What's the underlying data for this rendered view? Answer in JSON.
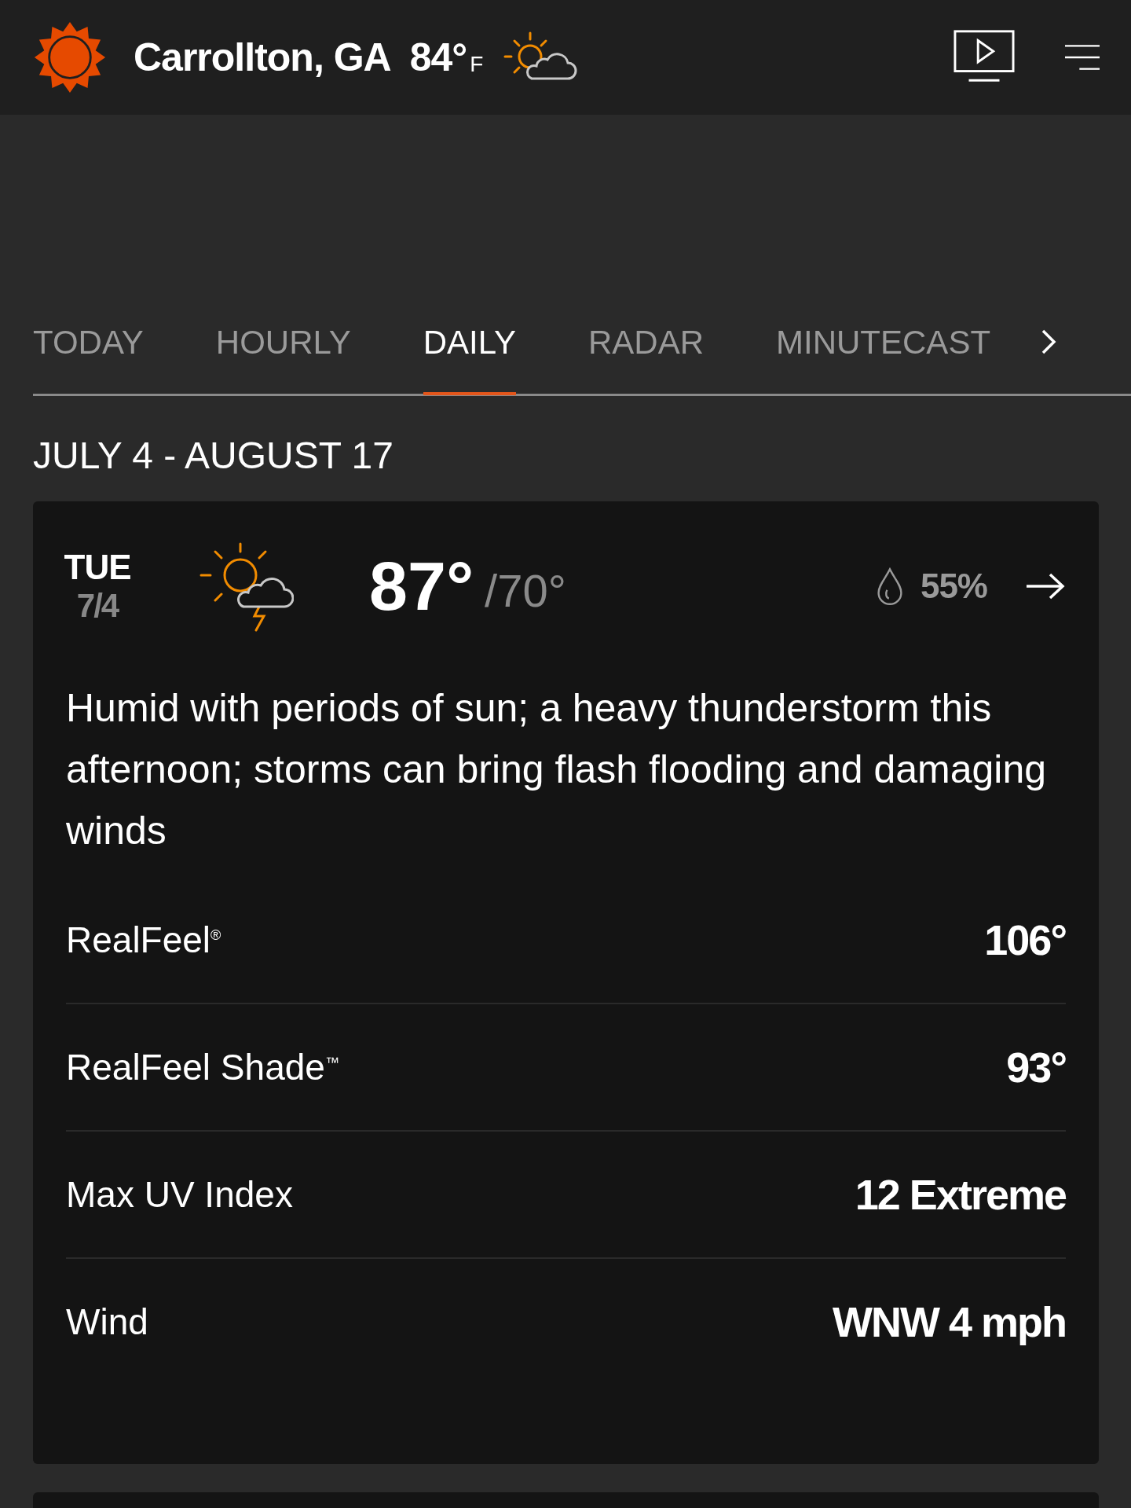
{
  "header": {
    "location": "Carrollton, GA",
    "temperature": "84°",
    "unit": "F"
  },
  "tabs": [
    {
      "label": "TODAY",
      "selected": false
    },
    {
      "label": "HOURLY",
      "selected": false
    },
    {
      "label": "DAILY",
      "selected": true
    },
    {
      "label": "RADAR",
      "selected": false
    },
    {
      "label": "MINUTECAST",
      "selected": false
    }
  ],
  "date_range": "JULY 4 - AUGUST 17",
  "day_card": {
    "day": "TUE",
    "date": "7/4",
    "high": "87°",
    "low": "/70°",
    "precipitation": "55%",
    "description": "Humid with periods of sun; a heavy thunderstorm this afternoon; storms can bring flash flooding and damaging winds",
    "details": [
      {
        "label": "RealFeel$^{®}$",
        "value": "106°"
      },
      {
        "label": "RealFeel Shade$^{™}$",
        "value": "93°"
      },
      {
        "label": "Max UV Index",
        "value": "12 Extreme"
      },
      {
        "label": "Wind",
        "value": "WNW 4 mph"
      }
    ]
  }
}
